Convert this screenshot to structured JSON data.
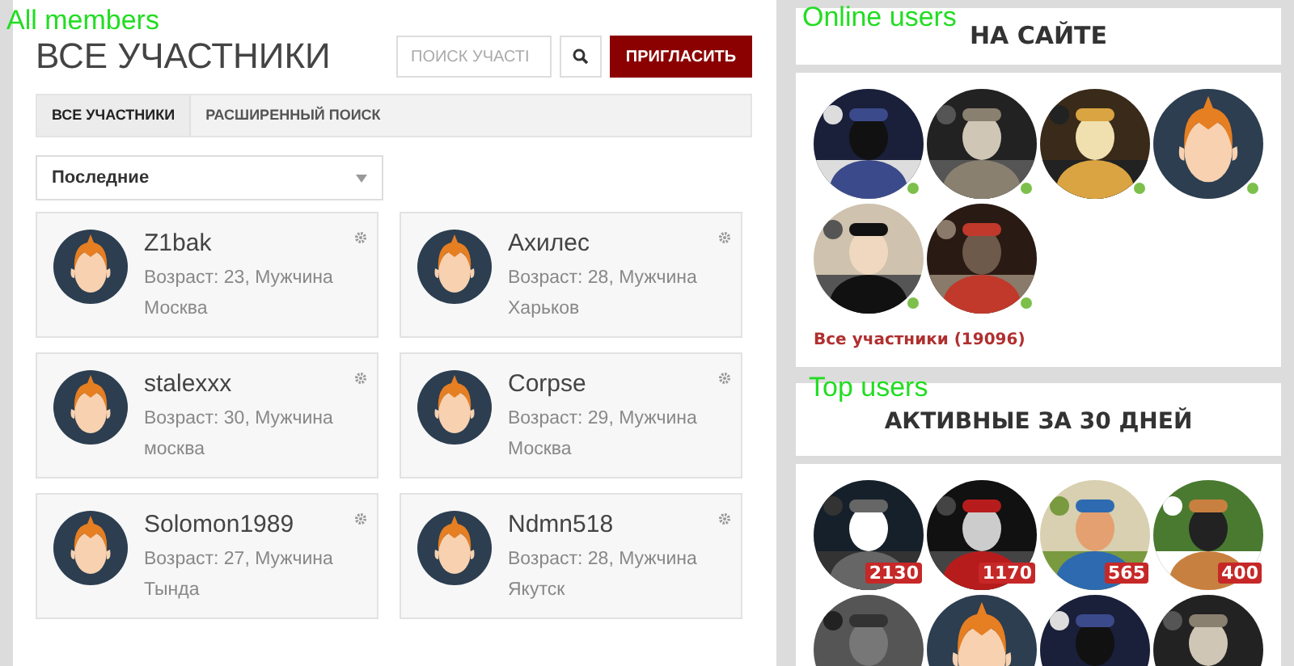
{
  "annotations": [
    {
      "text": "All members"
    },
    {
      "text": "Online users"
    },
    {
      "text": "Top users"
    }
  ],
  "members_page": {
    "title": "ВСЕ УЧАСТНИКИ",
    "search": {
      "placeholder": "ПОИСК УЧАСТІ"
    },
    "invite_button": "ПРИГЛАСИТЬ",
    "tabs": [
      {
        "label": "ВСЕ УЧАСТНИКИ",
        "selected": true
      },
      {
        "label": "РАСШИРЕННЫЙ ПОИСК",
        "selected": false
      }
    ],
    "sort": {
      "value": "Последние"
    },
    "members": [
      {
        "name": "Z1bak",
        "info": "Возраст: 23, Мужчина",
        "city": "Москва"
      },
      {
        "name": "Ахилес",
        "info": "Возраст: 28, Мужчина",
        "city": "Харьков"
      },
      {
        "name": "stalexxx",
        "info": "Возраст: 30, Мужчина",
        "city": "москва"
      },
      {
        "name": "Corpse",
        "info": "Возраст: 29, Мужчина",
        "city": "Москва"
      },
      {
        "name": "Solomon1989",
        "info": "Возраст: 27, Мужчина",
        "city": "Тында"
      },
      {
        "name": "Ndmn518",
        "info": "Возраст: 28, Мужчина",
        "city": "Якутск"
      }
    ]
  },
  "online": {
    "title": "НА САЙТЕ",
    "users": [
      {
        "kind": "picture"
      },
      {
        "kind": "picture"
      },
      {
        "kind": "picture"
      },
      {
        "kind": "default"
      },
      {
        "kind": "picture"
      },
      {
        "kind": "picture"
      }
    ],
    "all_link": "Все участники (19096)"
  },
  "top": {
    "title": "АКТИВНЫЕ ЗА 30 ДНЕЙ",
    "users": [
      {
        "kind": "picture",
        "count": "2130"
      },
      {
        "kind": "picture",
        "count": "1170"
      },
      {
        "kind": "picture",
        "count": "565"
      },
      {
        "kind": "picture",
        "count": "400"
      },
      {
        "kind": "picture"
      },
      {
        "kind": "default"
      },
      {
        "kind": "picture"
      },
      {
        "kind": "picture"
      }
    ]
  }
}
